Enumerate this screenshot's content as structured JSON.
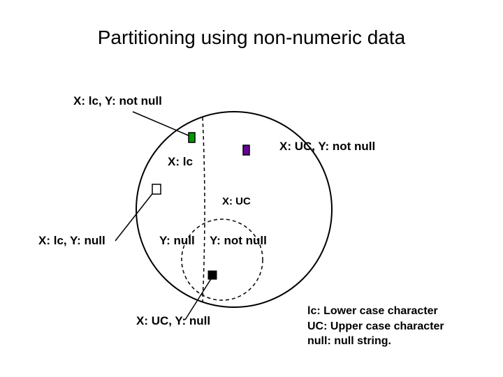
{
  "title": "Partitioning using non-numeric data",
  "labels": {
    "topLeft": "X: lc, Y: not null",
    "midLeft": "X: lc",
    "topRight": "X: UC, Y: not null",
    "midRight": "X: UC",
    "leftOuter": "X: lc, Y: null",
    "centerLeft": "Y: null",
    "centerRight": "Y: not null",
    "bottom": "X: UC, Y: null"
  },
  "legend": {
    "line1": "lc: Lower case character",
    "line2": "UC: Upper case  character",
    "line3": "null: null string."
  },
  "palette": {
    "circleStroke": "#000000",
    "greenFill": "#009900",
    "purpleFill": "#660099",
    "whiteFill": "#ffffff",
    "blackFill": "#000000"
  }
}
